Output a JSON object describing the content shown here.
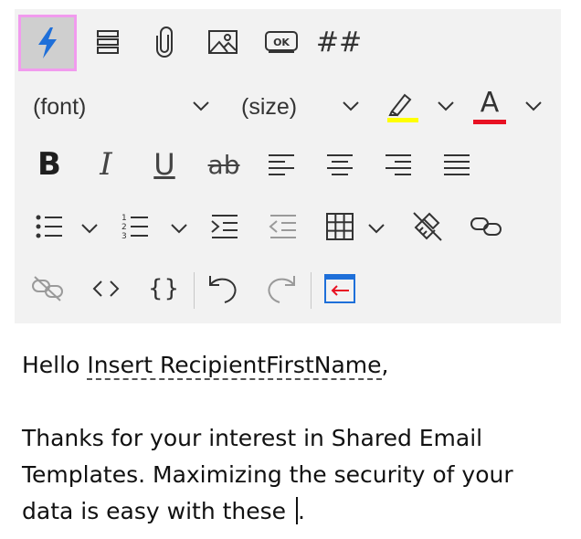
{
  "toolbar": {
    "font_label": "(font)",
    "size_label": "(size)",
    "snippet_label": "OK",
    "hash_label": "##",
    "bold_label": "B",
    "italic_label": "I",
    "underline_label": "U",
    "strike_label": "ab",
    "font_color_label": "A",
    "code_label": "<>",
    "braces_label": "{}",
    "colors": {
      "highlight": "#ffff00",
      "font_color": "#e81123",
      "active_icon": "#1e6fd9",
      "active_border": "#f19bee"
    }
  },
  "editor": {
    "greeting_prefix": "Hello ",
    "placeholder_token": "Insert RecipientFirstName",
    "greeting_suffix": ",",
    "body_text": "Thanks for your interest in Shared Email Templates. Maximizing the security of your data is easy with these ",
    "body_end": "."
  }
}
